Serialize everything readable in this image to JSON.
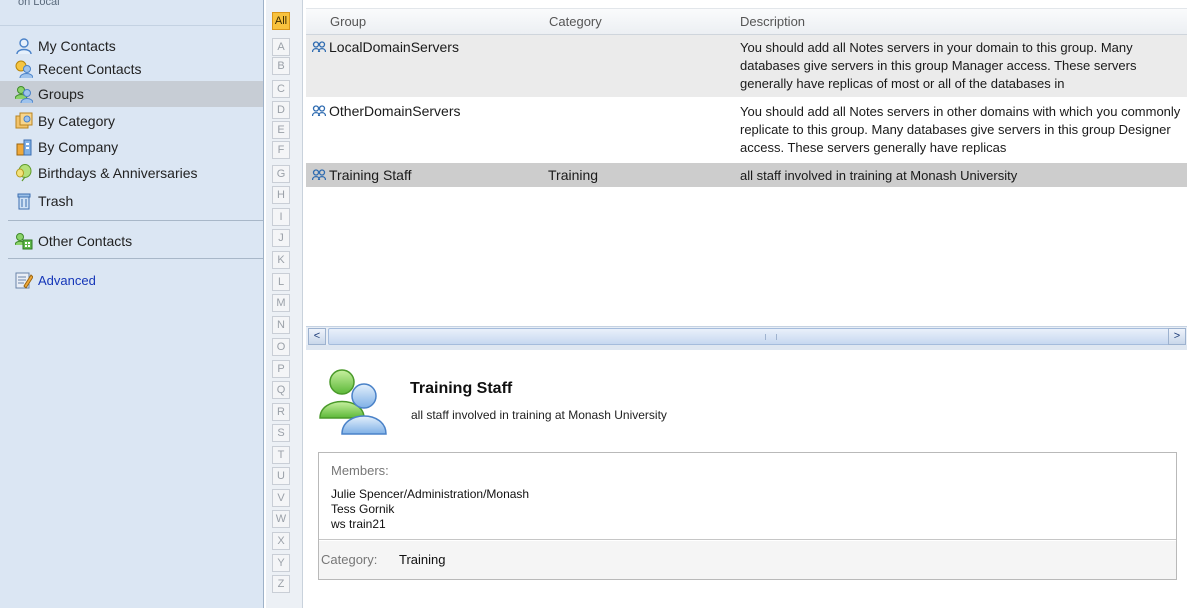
{
  "sidebar": {
    "cut_title": "on Local",
    "items": [
      {
        "label": "My Contacts",
        "icon": "person-icon"
      },
      {
        "label": "Recent Contacts",
        "icon": "recent-contacts-icon"
      },
      {
        "label": "Groups",
        "icon": "groups-icon"
      },
      {
        "label": "By Category",
        "icon": "category-icon"
      },
      {
        "label": "By Company",
        "icon": "company-icon"
      },
      {
        "label": "Birthdays & Anniversaries",
        "icon": "balloon-icon"
      },
      {
        "label": "Trash",
        "icon": "trash-icon"
      },
      {
        "label": "Other Contacts",
        "icon": "other-contacts-icon"
      },
      {
        "label": "Advanced",
        "icon": "advanced-icon"
      }
    ],
    "selected": "Groups"
  },
  "alphabet": [
    "All",
    "A",
    "B",
    "C",
    "D",
    "E",
    "F",
    "G",
    "H",
    "I",
    "J",
    "K",
    "L",
    "M",
    "N",
    "O",
    "P",
    "Q",
    "R",
    "S",
    "T",
    "U",
    "V",
    "W",
    "X",
    "Y",
    "Z"
  ],
  "view": {
    "columns": {
      "group": "Group",
      "category": "Category",
      "description": "Description"
    },
    "rows": [
      {
        "name": "LocalDomainServers",
        "category": "",
        "description": "You should add all Notes servers in your domain to this group.  Many databases give servers in this group Manager access.  These servers generally have replicas of most or all of the databases in"
      },
      {
        "name": "OtherDomainServers",
        "category": "",
        "description": "You should add all Notes servers in other domains with which you commonly replicate to this group.  Many databases give servers in this group Designer access.  These servers generally have replicas"
      },
      {
        "name": "Training Staff",
        "category": "Training",
        "description": "all staff involved in training at Monash University"
      }
    ]
  },
  "scrollbar": {
    "left_arrow": "<",
    "right_arrow": ">"
  },
  "preview": {
    "title": "Training Staff",
    "subtitle": "all staff involved in training at Monash University",
    "members_label": "Members:",
    "members": [
      "Julie Spencer/Administration/Monash",
      "Tess Gornik",
      "ws train21"
    ],
    "category_label": "Category:",
    "category_value": "Training"
  },
  "colors": {
    "sidebar_bg": "#dbe6f3",
    "selected_bg": "#c7cdd5",
    "active_letter": "#f8c23d",
    "selected_row": "#cdcdcd",
    "link": "#1536b8"
  }
}
